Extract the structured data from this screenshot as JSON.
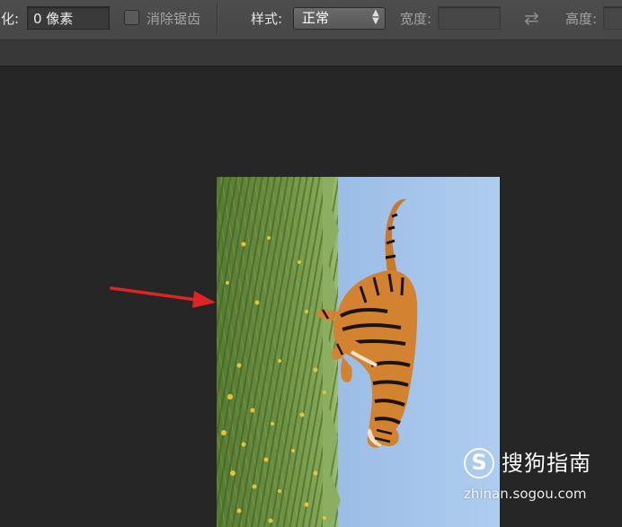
{
  "options_bar": {
    "feather_label": "羽化:",
    "feather_value": "0 像素",
    "antialias_label": "消除锯齿",
    "antialias_checked": false,
    "style_label": "样式:",
    "style_value": "正常",
    "width_label": "宽度:",
    "width_value": "",
    "height_label": "高度:",
    "height_value": "",
    "swap_icon": "swap-arrows-icon"
  },
  "canvas": {
    "image_subject": "tiger",
    "annotation": "red-arrow-icon",
    "annotation_color": "#e02424"
  },
  "watermark": {
    "logo_letter": "S",
    "brand": "搜狗指南",
    "url": "zhinan.sogou.com"
  }
}
